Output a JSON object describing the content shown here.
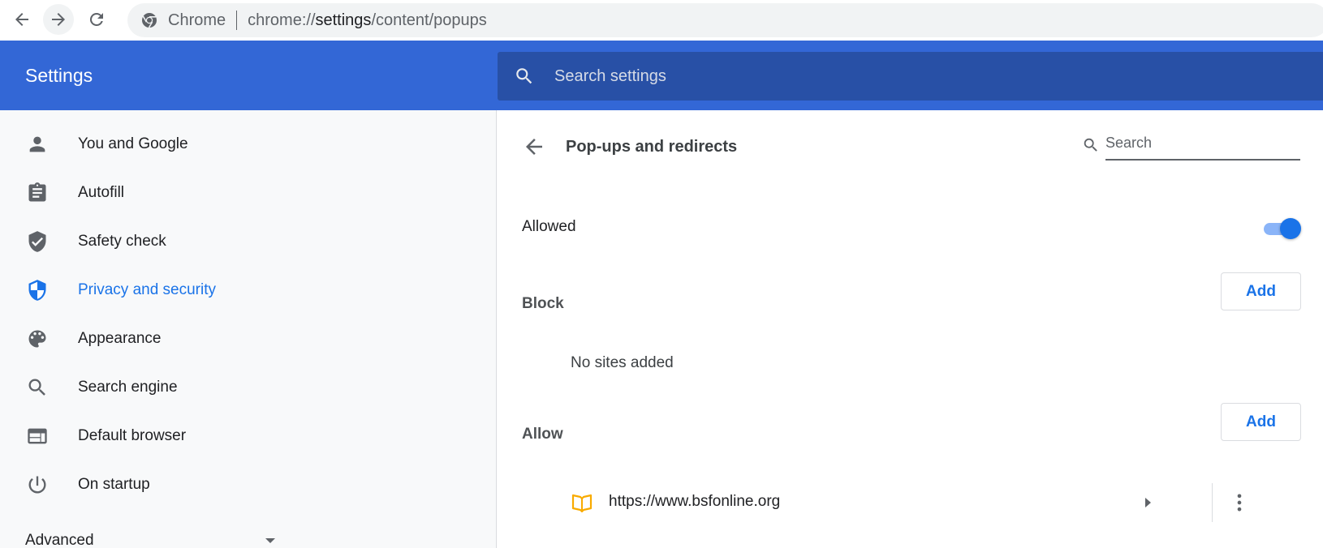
{
  "browser": {
    "omnibox_label": "Chrome",
    "url_prefix": "chrome://",
    "url_host": "settings",
    "url_path": "/content/popups"
  },
  "header": {
    "title": "Settings",
    "search_placeholder": "Search settings"
  },
  "sidebar": {
    "items": [
      {
        "label": "You and Google",
        "icon": "person-icon"
      },
      {
        "label": "Autofill",
        "icon": "clipboard-icon"
      },
      {
        "label": "Safety check",
        "icon": "shield-check-icon"
      },
      {
        "label": "Privacy and security",
        "icon": "shield-icon",
        "active": true
      },
      {
        "label": "Appearance",
        "icon": "palette-icon"
      },
      {
        "label": "Search engine",
        "icon": "search-icon"
      },
      {
        "label": "Default browser",
        "icon": "browser-window-icon"
      },
      {
        "label": "On startup",
        "icon": "power-icon"
      }
    ],
    "advanced_label": "Advanced"
  },
  "main": {
    "title": "Pop-ups and redirects",
    "search_placeholder": "Search",
    "allowed_label": "Allowed",
    "allowed_toggle_on": true,
    "block": {
      "label": "Block",
      "add_label": "Add",
      "empty_text": "No sites added"
    },
    "allow": {
      "label": "Allow",
      "add_label": "Add",
      "sites": [
        {
          "url": "https://www.bsfonline.org",
          "icon": "open-book-icon"
        }
      ]
    }
  },
  "colors": {
    "header_blue": "#3367d6",
    "search_blue": "#2850a6",
    "accent": "#1a73e8",
    "site_icon": "#f9ab00"
  }
}
